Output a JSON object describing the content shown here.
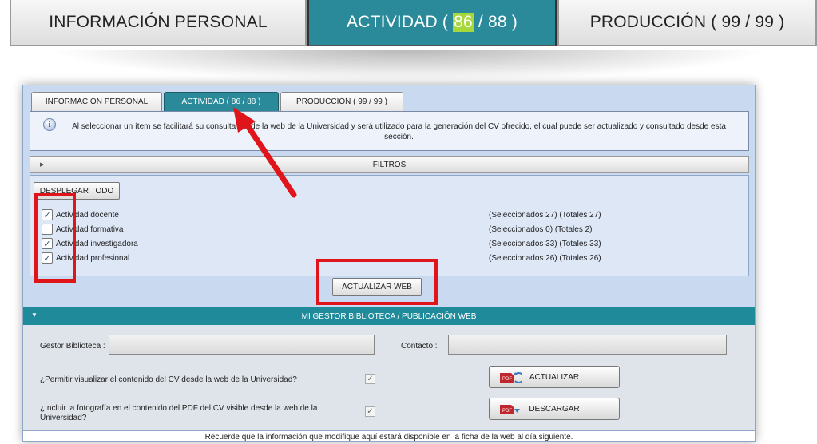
{
  "zoomed_tabs": {
    "personal": "INFORMACIÓN PERSONAL",
    "actividad_prefix": "ACTIVIDAD (",
    "actividad_selected": "86",
    "actividad_suffix": "/ 88 )",
    "produccion": "PRODUCCIÓN ( 99 / 99 )"
  },
  "tabs": [
    {
      "label": "INFORMACIÓN PERSONAL"
    },
    {
      "label": "ACTIVIDAD ( 86 / 88 )"
    },
    {
      "label": "PRODUCCIÓN ( 99 / 99 )"
    }
  ],
  "info_text": "Al seleccionar un ítem se facilitará su consulta desde la web de la Universidad y será utilizado para la generación del CV ofrecido, el cual puede ser actualizado y consultado desde esta sección.",
  "filters_label": "FILTROS",
  "expand_all_label": "DESPLEGAR TODO",
  "activities": [
    {
      "label": "Actividad docente",
      "checked": true,
      "counts": "(Seleccionados 27) (Totales 27)"
    },
    {
      "label": "Actividad formativa",
      "checked": false,
      "counts": "(Seleccionados 0) (Totales 2)"
    },
    {
      "label": "Actividad investigadora",
      "checked": true,
      "counts": "(Seleccionados 33) (Totales 33)"
    },
    {
      "label": "Actividad profesional",
      "checked": true,
      "counts": "(Seleccionados 26) (Totales 26)"
    }
  ],
  "update_web_label": "ACTUALIZAR WEB",
  "gestor_title": "MI GESTOR BIBLIOTECA / PUBLICACIÓN WEB",
  "gestor": {
    "biblioteca_label": "Gestor Biblioteca :",
    "contacto_label": "Contacto :",
    "q1": "¿Permitir visualizar el contenido del CV desde la web de la Universidad?",
    "q2": "¿Incluir la fotografía en el contenido del PDF del CV visible desde la web de la Universidad?",
    "update_label": "ACTUALIZAR",
    "download_label": "DESCARGAR"
  },
  "footer_note": "Recuerde que la información que modifique aquí estará disponible en la ficha de la web al día siguiente.",
  "colors": {
    "accent": "#2a8a9a",
    "highlight": "#a6d83c",
    "annotation": "#e0151b"
  }
}
